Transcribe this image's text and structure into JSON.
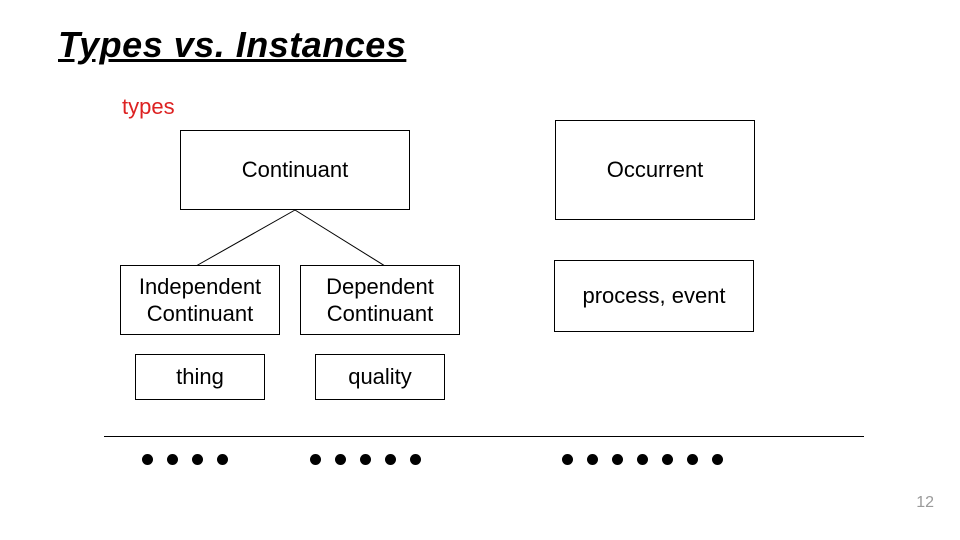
{
  "title": "Types vs. Instances",
  "types_label": "types",
  "boxes": {
    "continuant": "Continuant",
    "occurrent": "Occurrent",
    "independent": "Independent\nContinuant",
    "dependent": "Dependent\nContinuant",
    "process": "process, event",
    "thing": "thing",
    "quality": "quality"
  },
  "dot_counts": {
    "group1": 4,
    "group2": 5,
    "group3": 7
  },
  "page_number": "12"
}
